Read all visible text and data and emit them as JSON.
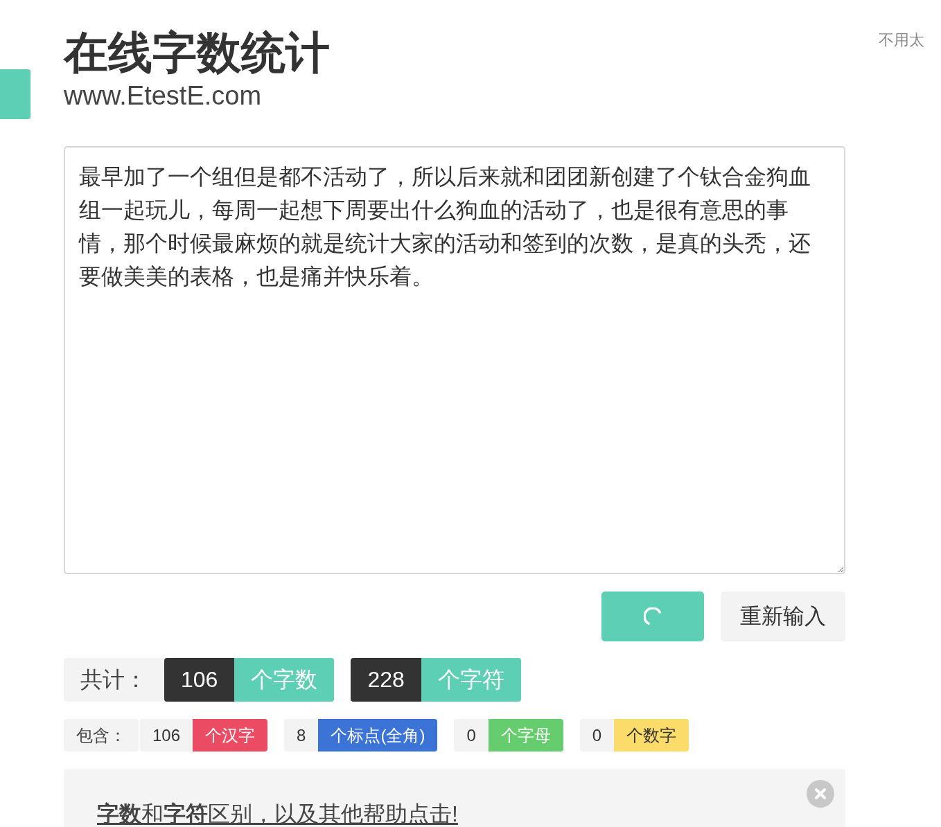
{
  "header": {
    "title": "在线字数统计",
    "subtitle": "www.EtestE.com",
    "side_note": "不用太"
  },
  "editor": {
    "value": "最早加了一个组但是都不活动了，所以后来就和团团新创建了个钛合金狗血组一起玩儿，每周一起想下周要出什么狗血的活动了，也是很有意思的事情，那个时候最麻烦的就是统计大家的活动和签到的次数，是真的头秃，还要做美美的表格，也是痛并快乐着。"
  },
  "buttons": [
    {
      "kind": "loading"
    },
    {
      "kind": "text",
      "label": "重新输入"
    }
  ],
  "totals": {
    "label": "共计：",
    "items": [
      {
        "count": "106",
        "unit": "个字数"
      },
      {
        "count": "228",
        "unit": "个字符"
      }
    ]
  },
  "breakdown": {
    "label": "包含：",
    "items": [
      {
        "count": "106",
        "unit": "个汉字",
        "color": "#ec4b64"
      },
      {
        "count": "8",
        "unit": "个标点(全角)",
        "color": "#3b74d6"
      },
      {
        "count": "0",
        "unit": "个字母",
        "color": "#66cd6e"
      },
      {
        "count": "0",
        "unit": "个数字",
        "color": "#fbdc6a"
      }
    ]
  },
  "help": {
    "link": "**字数**和**字符**区别，以及其他帮助点击!"
  }
}
